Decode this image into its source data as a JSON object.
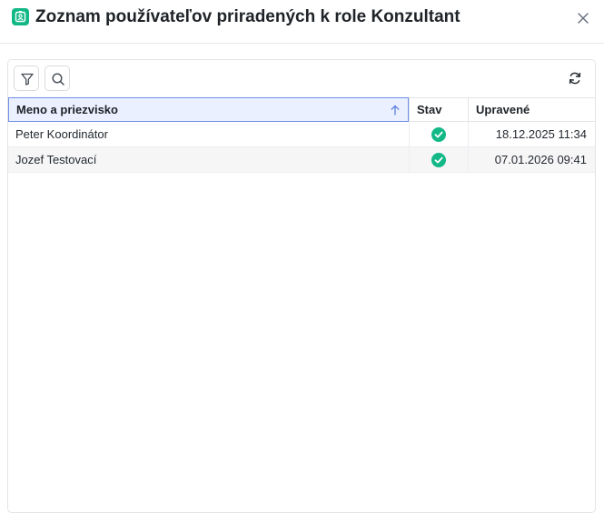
{
  "dialog": {
    "title": "Zoznam používateľov priradených k role Konzultant",
    "title_icon": "id-badge-icon",
    "close_icon": "close-icon"
  },
  "toolbar": {
    "filter_icon": "filter-icon",
    "search_icon": "search-icon",
    "refresh_icon": "refresh-icon"
  },
  "table": {
    "columns": [
      {
        "label": "Meno a priezvisko",
        "sort": "ascending"
      },
      {
        "label": "Stav"
      },
      {
        "label": "Upravené"
      }
    ],
    "rows": [
      {
        "name": "Peter Koordinátor",
        "status": "active",
        "updated": "18.12.2025 11:34"
      },
      {
        "name": "Jozef Testovací",
        "status": "active",
        "updated": "07.01.2026 09:41"
      }
    ]
  },
  "colors": {
    "accent": "#12b886",
    "status_active": "#12b886",
    "sorted_header_bg": "#eaf0ff",
    "sorted_header_border": "#6f8fe8"
  }
}
